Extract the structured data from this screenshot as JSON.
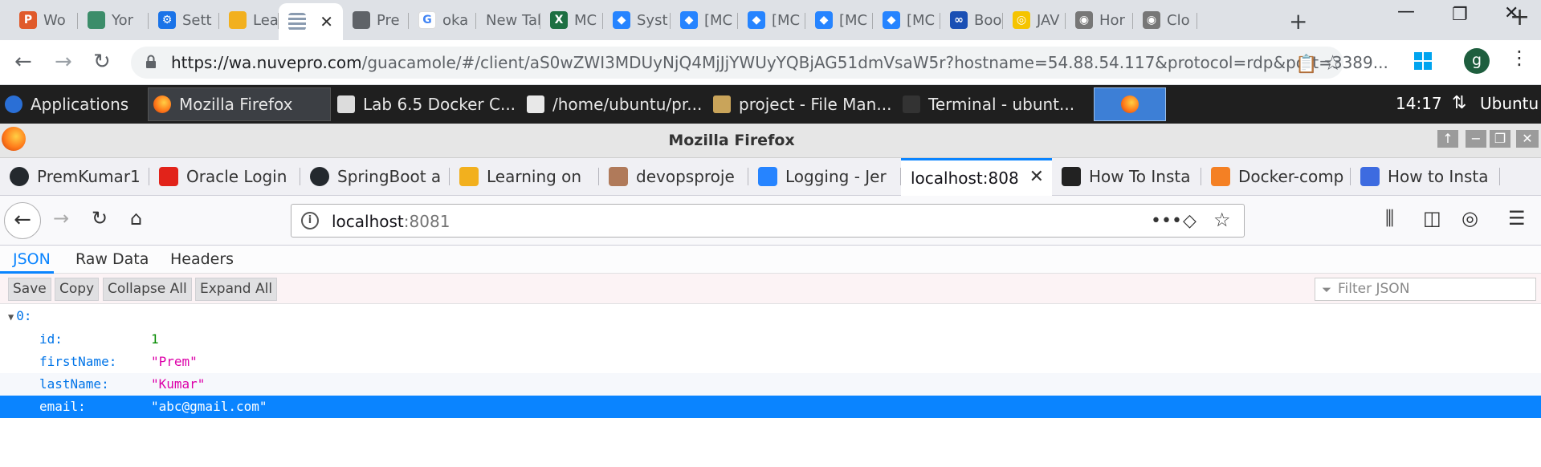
{
  "chrome": {
    "tabs": [
      {
        "label": "Wo",
        "icon": "p-icon",
        "color": "#e05a2b",
        "glyph": "P"
      },
      {
        "label": "Yor",
        "icon": "cube-icon",
        "color": "#3c8d6a",
        "glyph": ""
      },
      {
        "label": "Sett",
        "icon": "gear-icon",
        "color": "#1a73e8",
        "glyph": "⚙"
      },
      {
        "label": "Lea",
        "icon": "bars-icon",
        "color": "#f2b01e",
        "glyph": ""
      },
      {
        "label": "",
        "icon": "guacamole-icon",
        "color": "#8a9bb0",
        "glyph": "",
        "active": true
      },
      {
        "label": "Pre",
        "icon": "globe-icon",
        "color": "#5f6368",
        "glyph": ""
      },
      {
        "label": "oka",
        "icon": "google-icon",
        "color": "#fff",
        "glyph": "G"
      },
      {
        "label": "New Tab",
        "icon": "",
        "color": "",
        "glyph": ""
      },
      {
        "label": "MC",
        "icon": "excel-icon",
        "color": "#1d6f42",
        "glyph": "X"
      },
      {
        "label": "Syst",
        "icon": "jira-icon",
        "color": "#2684ff",
        "glyph": "◆"
      },
      {
        "label": "[MC",
        "icon": "jira-icon",
        "color": "#2684ff",
        "glyph": "◆"
      },
      {
        "label": "[MC",
        "icon": "jira-icon",
        "color": "#2684ff",
        "glyph": "◆"
      },
      {
        "label": "[MC",
        "icon": "jira-icon",
        "color": "#2684ff",
        "glyph": "◆"
      },
      {
        "label": "[MC",
        "icon": "jira-icon",
        "color": "#2684ff",
        "glyph": "◆"
      },
      {
        "label": "Boo",
        "icon": "link-icon",
        "color": "#1a4fb4",
        "glyph": "∞"
      },
      {
        "label": "JAV",
        "icon": "java-icon",
        "color": "#f5c400",
        "glyph": "◎"
      },
      {
        "label": "Hor",
        "icon": "chromium-icon",
        "color": "#777",
        "glyph": "◉"
      },
      {
        "label": "Clo",
        "icon": "chromium-icon",
        "color": "#777",
        "glyph": "◉"
      }
    ],
    "url_host": "https://wa.nuvepro.com",
    "url_path": "/guacamole/#/client/aS0wZWI3MDUyNjQ4MjJjYWUyYQBjAG51dmVsaW5r?hostname=54.88.54.117&protocol=rdp&port=3389...",
    "avatar_letter": "g"
  },
  "xpanel": {
    "apps_label": "Applications",
    "tasks": [
      {
        "label": "Mozilla Firefox",
        "active": true
      },
      {
        "label": "Lab 6.5 Docker C..."
      },
      {
        "label": "/home/ubuntu/pr..."
      },
      {
        "label": "project - File Man..."
      },
      {
        "label": "Terminal - ubunt..."
      }
    ],
    "clock": "14:17",
    "user": "Ubuntu"
  },
  "firefox": {
    "title": "Mozilla Firefox",
    "tabs": [
      {
        "label": "PremKumar1"
      },
      {
        "label": "Oracle Login"
      },
      {
        "label": "SpringBoot a"
      },
      {
        "label": "Learning on"
      },
      {
        "label": "devopsproje"
      },
      {
        "label": "Logging - Jer"
      },
      {
        "label": "localhost:808",
        "active": true
      },
      {
        "label": "How To Insta"
      },
      {
        "label": "Docker-comp"
      },
      {
        "label": "How to Insta"
      }
    ],
    "url_host": "localhost",
    "url_port": ":8081"
  },
  "json_viewer": {
    "tabs": [
      "JSON",
      "Raw Data",
      "Headers"
    ],
    "toolbar": [
      "Save",
      "Copy",
      "Collapse All",
      "Expand All"
    ],
    "filter_placeholder": "Filter JSON",
    "root_key": "0:",
    "rows": [
      {
        "key": "id:",
        "value": "1",
        "type": "num"
      },
      {
        "key": "firstName:",
        "value": "\"Prem\"",
        "type": "str"
      },
      {
        "key": "lastName:",
        "value": "\"Kumar\"",
        "type": "str"
      },
      {
        "key": "email:",
        "value": "\"abc@gmail.com\"",
        "type": "str",
        "selected": true
      }
    ]
  }
}
